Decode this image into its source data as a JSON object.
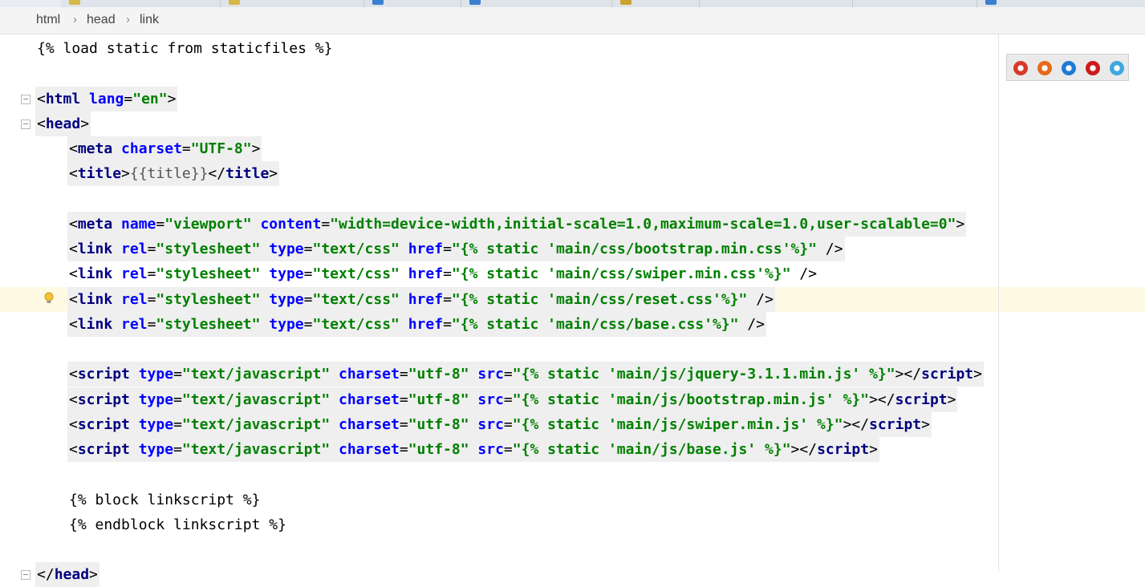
{
  "breadcrumb": [
    "html",
    "head",
    "link"
  ],
  "browser_icons": [
    {
      "name": "chrome-icon",
      "color": "#d8392b"
    },
    {
      "name": "firefox-icon",
      "color": "#e66a1a"
    },
    {
      "name": "safari-icon",
      "color": "#1f7ad6"
    },
    {
      "name": "opera-icon",
      "color": "#cc1b1b"
    },
    {
      "name": "ie-icon",
      "color": "#3ea8de"
    }
  ],
  "current_line": 10,
  "lines": [
    {
      "indent": 0,
      "hl": false,
      "fold": false,
      "tokens": [
        [
          "t-tpl",
          "{% load static from staticfiles %}"
        ]
      ]
    },
    {
      "indent": 0,
      "hl": false,
      "fold": false,
      "tokens": []
    },
    {
      "indent": 0,
      "hl": true,
      "fold": true,
      "tokens": [
        [
          "t-pun",
          "<"
        ],
        [
          "t-tag",
          "html"
        ],
        [
          "t-pun",
          " "
        ],
        [
          "t-attr",
          "lang"
        ],
        [
          "t-pun",
          "="
        ],
        [
          "t-str",
          "\"en\""
        ],
        [
          "t-pun",
          ">"
        ]
      ]
    },
    {
      "indent": 0,
      "hl": true,
      "fold": true,
      "tokens": [
        [
          "t-pun",
          "<"
        ],
        [
          "t-tag",
          "head"
        ],
        [
          "t-pun",
          ">"
        ]
      ]
    },
    {
      "indent": 1,
      "hl": true,
      "fold": false,
      "tokens": [
        [
          "t-pun",
          "<"
        ],
        [
          "t-tag",
          "meta"
        ],
        [
          "t-pun",
          " "
        ],
        [
          "t-attr",
          "charset"
        ],
        [
          "t-pun",
          "="
        ],
        [
          "t-str",
          "\"UTF-8\""
        ],
        [
          "t-pun",
          ">"
        ]
      ]
    },
    {
      "indent": 1,
      "hl": true,
      "fold": false,
      "tokens": [
        [
          "t-pun",
          "<"
        ],
        [
          "t-tag",
          "title"
        ],
        [
          "t-pun",
          ">"
        ],
        [
          "t-gray",
          "{{title}}"
        ],
        [
          "t-pun",
          "</"
        ],
        [
          "t-tag",
          "title"
        ],
        [
          "t-pun",
          ">"
        ]
      ]
    },
    {
      "indent": 0,
      "hl": false,
      "fold": false,
      "tokens": []
    },
    {
      "indent": 1,
      "hl": true,
      "fold": false,
      "tokens": [
        [
          "t-pun",
          "<"
        ],
        [
          "t-tag",
          "meta"
        ],
        [
          "t-pun",
          " "
        ],
        [
          "t-attr",
          "name"
        ],
        [
          "t-pun",
          "="
        ],
        [
          "t-str",
          "\"viewport\""
        ],
        [
          "t-pun",
          " "
        ],
        [
          "t-attr",
          "content"
        ],
        [
          "t-pun",
          "="
        ],
        [
          "t-str",
          "\"width=device-width,initial-scale=1.0,maximum-scale=1.0,user-scalable=0\""
        ],
        [
          "t-pun",
          ">"
        ]
      ]
    },
    {
      "indent": 1,
      "hl": true,
      "fold": false,
      "tokens": [
        [
          "t-pun",
          "<"
        ],
        [
          "t-tag",
          "link"
        ],
        [
          "t-pun",
          " "
        ],
        [
          "t-attr",
          "rel"
        ],
        [
          "t-pun",
          "="
        ],
        [
          "t-str",
          "\"stylesheet\""
        ],
        [
          "t-pun",
          " "
        ],
        [
          "t-attr",
          "type"
        ],
        [
          "t-pun",
          "="
        ],
        [
          "t-str",
          "\"text/css\""
        ],
        [
          "t-pun",
          " "
        ],
        [
          "t-attr",
          "href"
        ],
        [
          "t-pun",
          "="
        ],
        [
          "t-str",
          "\"{% static 'main/css/bootstrap.min.css'%}\""
        ],
        [
          "t-pun",
          " />"
        ]
      ]
    },
    {
      "indent": 1,
      "hl": false,
      "fold": false,
      "tokens": [
        [
          "t-pun",
          "<"
        ],
        [
          "t-tag",
          "link"
        ],
        [
          "t-pun",
          " "
        ],
        [
          "t-attr",
          "rel"
        ],
        [
          "t-pun",
          "="
        ],
        [
          "t-str",
          "\"stylesheet\""
        ],
        [
          "t-pun",
          " "
        ],
        [
          "t-attr",
          "type"
        ],
        [
          "t-pun",
          "="
        ],
        [
          "t-str",
          "\"text/css\""
        ],
        [
          "t-pun",
          " "
        ],
        [
          "t-attr",
          "href"
        ],
        [
          "t-pun",
          "="
        ],
        [
          "t-str",
          "\"{% static 'main/css/swiper.min.css'%}\""
        ],
        [
          "t-pun",
          " />"
        ]
      ]
    },
    {
      "indent": 1,
      "hl": true,
      "fold": false,
      "tokens": [
        [
          "t-pun",
          "<"
        ],
        [
          "t-tag",
          "link"
        ],
        [
          "t-pun",
          " "
        ],
        [
          "t-attr",
          "rel"
        ],
        [
          "t-pun",
          "="
        ],
        [
          "t-str",
          "\"stylesheet\""
        ],
        [
          "t-pun",
          " "
        ],
        [
          "t-attr",
          "type"
        ],
        [
          "t-pun",
          "="
        ],
        [
          "t-str",
          "\"text/css\""
        ],
        [
          "t-pun",
          " "
        ],
        [
          "t-attr",
          "href"
        ],
        [
          "t-pun",
          "="
        ],
        [
          "t-str",
          "\"{% static 'main/css/reset.css'%}\""
        ],
        [
          "t-pun",
          " />"
        ]
      ]
    },
    {
      "indent": 1,
      "hl": true,
      "fold": false,
      "tokens": [
        [
          "t-pun",
          "<"
        ],
        [
          "t-tag",
          "link"
        ],
        [
          "t-pun",
          " "
        ],
        [
          "t-attr",
          "rel"
        ],
        [
          "t-pun",
          "="
        ],
        [
          "t-str",
          "\"stylesheet\""
        ],
        [
          "t-pun",
          " "
        ],
        [
          "t-attr",
          "type"
        ],
        [
          "t-pun",
          "="
        ],
        [
          "t-str",
          "\"text/css\""
        ],
        [
          "t-pun",
          " "
        ],
        [
          "t-attr",
          "href"
        ],
        [
          "t-pun",
          "="
        ],
        [
          "t-str",
          "\"{% static 'main/css/base.css'%}\""
        ],
        [
          "t-pun",
          " />"
        ]
      ]
    },
    {
      "indent": 0,
      "hl": false,
      "fold": false,
      "tokens": []
    },
    {
      "indent": 1,
      "hl": true,
      "fold": false,
      "tokens": [
        [
          "t-pun",
          "<"
        ],
        [
          "t-tag",
          "script"
        ],
        [
          "t-pun",
          " "
        ],
        [
          "t-attr",
          "type"
        ],
        [
          "t-pun",
          "="
        ],
        [
          "t-str",
          "\"text/javascript\""
        ],
        [
          "t-pun",
          " "
        ],
        [
          "t-attr",
          "charset"
        ],
        [
          "t-pun",
          "="
        ],
        [
          "t-str",
          "\"utf-8\""
        ],
        [
          "t-pun",
          " "
        ],
        [
          "t-attr",
          "src"
        ],
        [
          "t-pun",
          "="
        ],
        [
          "t-str",
          "\"{% static 'main/js/jquery-3.1.1.min.js' %}\""
        ],
        [
          "t-pun",
          "></"
        ],
        [
          "t-tag",
          "script"
        ],
        [
          "t-pun",
          ">"
        ]
      ]
    },
    {
      "indent": 1,
      "hl": true,
      "fold": false,
      "tokens": [
        [
          "t-pun",
          "<"
        ],
        [
          "t-tag",
          "script"
        ],
        [
          "t-pun",
          " "
        ],
        [
          "t-attr",
          "type"
        ],
        [
          "t-pun",
          "="
        ],
        [
          "t-str",
          "\"text/javascript\""
        ],
        [
          "t-pun",
          " "
        ],
        [
          "t-attr",
          "charset"
        ],
        [
          "t-pun",
          "="
        ],
        [
          "t-str",
          "\"utf-8\""
        ],
        [
          "t-pun",
          " "
        ],
        [
          "t-attr",
          "src"
        ],
        [
          "t-pun",
          "="
        ],
        [
          "t-str",
          "\"{% static 'main/js/bootstrap.min.js' %}\""
        ],
        [
          "t-pun",
          "></"
        ],
        [
          "t-tag",
          "script"
        ],
        [
          "t-pun",
          ">"
        ]
      ]
    },
    {
      "indent": 1,
      "hl": true,
      "fold": false,
      "tokens": [
        [
          "t-pun",
          "<"
        ],
        [
          "t-tag",
          "script"
        ],
        [
          "t-pun",
          " "
        ],
        [
          "t-attr",
          "type"
        ],
        [
          "t-pun",
          "="
        ],
        [
          "t-str",
          "\"text/javascript\""
        ],
        [
          "t-pun",
          " "
        ],
        [
          "t-attr",
          "charset"
        ],
        [
          "t-pun",
          "="
        ],
        [
          "t-str",
          "\"utf-8\""
        ],
        [
          "t-pun",
          " "
        ],
        [
          "t-attr",
          "src"
        ],
        [
          "t-pun",
          "="
        ],
        [
          "t-str",
          "\"{% static 'main/js/swiper.min.js' %}\""
        ],
        [
          "t-pun",
          "></"
        ],
        [
          "t-tag",
          "script"
        ],
        [
          "t-pun",
          ">"
        ]
      ]
    },
    {
      "indent": 1,
      "hl": true,
      "fold": false,
      "tokens": [
        [
          "t-pun",
          "<"
        ],
        [
          "t-tag",
          "script"
        ],
        [
          "t-pun",
          " "
        ],
        [
          "t-attr",
          "type"
        ],
        [
          "t-pun",
          "="
        ],
        [
          "t-str",
          "\"text/javascript\""
        ],
        [
          "t-pun",
          " "
        ],
        [
          "t-attr",
          "charset"
        ],
        [
          "t-pun",
          "="
        ],
        [
          "t-str",
          "\"utf-8\""
        ],
        [
          "t-pun",
          " "
        ],
        [
          "t-attr",
          "src"
        ],
        [
          "t-pun",
          "="
        ],
        [
          "t-str",
          "\"{% static 'main/js/base.js' %}\""
        ],
        [
          "t-pun",
          "></"
        ],
        [
          "t-tag",
          "script"
        ],
        [
          "t-pun",
          ">"
        ]
      ]
    },
    {
      "indent": 0,
      "hl": false,
      "fold": false,
      "tokens": []
    },
    {
      "indent": 1,
      "hl": false,
      "fold": false,
      "tokens": [
        [
          "t-tpl",
          "{% block linkscript %}"
        ]
      ]
    },
    {
      "indent": 1,
      "hl": false,
      "fold": false,
      "tokens": [
        [
          "t-tpl",
          "{% endblock linkscript %}"
        ]
      ]
    },
    {
      "indent": 0,
      "hl": false,
      "fold": false,
      "tokens": []
    },
    {
      "indent": 0,
      "hl": true,
      "fold": true,
      "tokens": [
        [
          "t-pun",
          "</"
        ],
        [
          "t-tag",
          "head"
        ],
        [
          "t-pun",
          ">"
        ]
      ]
    }
  ]
}
